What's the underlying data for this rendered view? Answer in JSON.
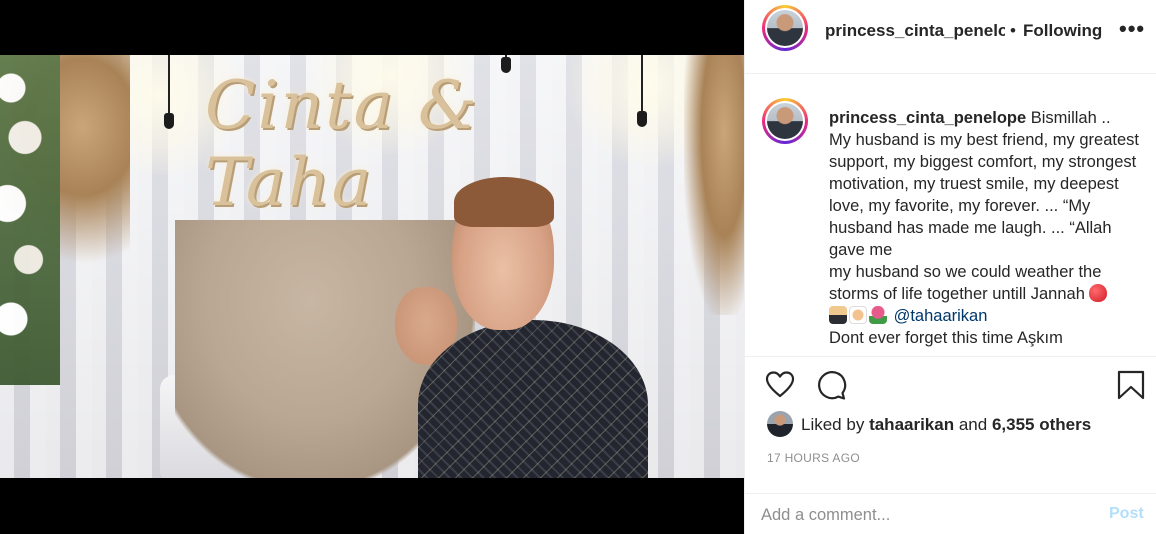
{
  "post": {
    "username": "princess_cinta_penelope",
    "separator": "•",
    "follow_status": "Following",
    "more_icon": "more-options-icon",
    "photo": {
      "sign_text": "Cinta & Taha"
    },
    "caption": {
      "username": "princess_cinta_penelope",
      "lines": [
        "Bismillah ..",
        "My husband is my best friend, my greatest support, my biggest comfort, my strongest motivation, my truest smile, my deepest love, my favorite, my forever. ... “My husband has made me laugh. ... “Allah gave me",
        "my husband so we could weather the storms of life together untill Jannah"
      ],
      "mention": "@tahaarikan",
      "last_line": "Dont ever forget this time Aşkım"
    },
    "actions": {
      "like_icon": "heart-icon",
      "comment_icon": "comment-icon",
      "save_icon": "bookmark-icon"
    },
    "likes": {
      "prefix": "Liked by",
      "liker": "tahaarikan",
      "and": "and",
      "others": "6,355 others"
    },
    "timestamp": "17 HOURS AGO",
    "comment": {
      "placeholder": "Add a comment...",
      "post_label": "Post"
    },
    "colors": {
      "link": "#00376b",
      "post_disabled": "#b2dffc",
      "muted": "#8e8e8e"
    }
  }
}
